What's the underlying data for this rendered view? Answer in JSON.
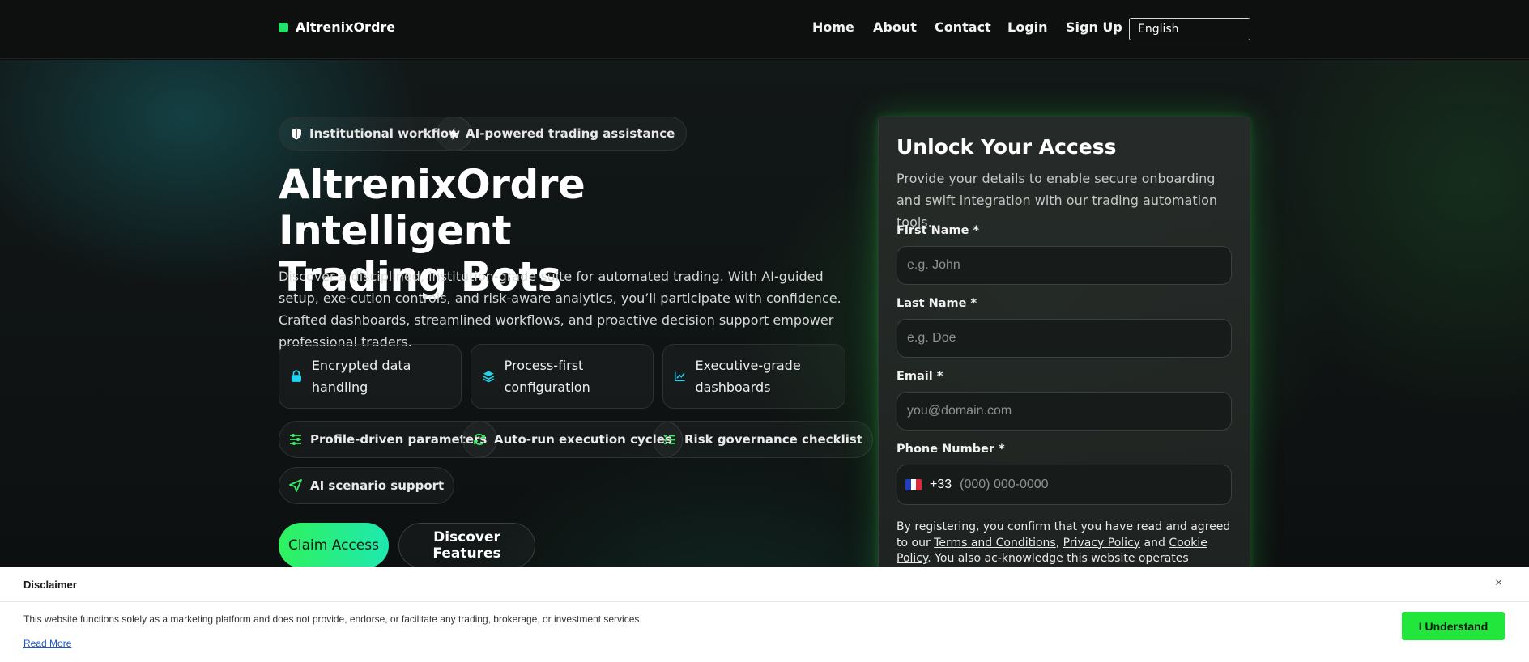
{
  "header": {
    "brand": "AltrenixOrdre",
    "nav": [
      "Home",
      "About",
      "Contact",
      "Login",
      "Sign Up"
    ],
    "language": "English"
  },
  "hero": {
    "badges": [
      "Institutional workflow",
      "AI-powered trading assistance"
    ],
    "title_line1": "AltrenixOrdre Intelligent",
    "title_line2": "Trading Bots",
    "lead": "Discover a disciplined, institution-grade suite for automated trading. With AI-guided setup, exe-cution controls, and risk-aware analytics, you’ll participate with confidence. Crafted dashboards, streamlined workflows, and proactive decision support empower professional traders.",
    "cards": [
      {
        "label": "Encrypted data handling",
        "icon": "lock-icon"
      },
      {
        "label": "Process-first configuration",
        "icon": "layers-icon"
      },
      {
        "label": "Executive-grade dashboards",
        "icon": "chart-line-icon"
      }
    ],
    "chips": [
      {
        "label": "Profile-driven parameters",
        "icon": "sliders-icon"
      },
      {
        "label": "Auto-run execution cycles",
        "icon": "refresh-icon"
      },
      {
        "label": "Risk governance checklist",
        "icon": "checklist-icon"
      },
      {
        "label": "AI scenario support",
        "icon": "send-icon"
      }
    ],
    "cta_primary": "Claim Access",
    "cta_secondary": "Discover Features"
  },
  "form": {
    "title": "Unlock Your Access",
    "subtitle": "Provide your details to enable secure onboarding and swift integration with our trading automation tools.",
    "first_name_label": "First Name *",
    "first_name_placeholder": "e.g. John",
    "last_name_label": "Last Name *",
    "last_name_placeholder": "e.g. Doe",
    "email_label": "Email *",
    "email_placeholder": "you@domain.com",
    "phone_label": "Phone Number *",
    "dial_code": "+33",
    "phone_placeholder": "(000) 000-0000",
    "consent_prefix": "By registering, you confirm that you have read and agreed to our ",
    "terms_link": "Terms and Conditions",
    "sep1": ", ",
    "privacy_link": "Privacy Policy",
    "and": " and ",
    "cookie_link": "Cookie Policy",
    "consent_suffix": ". You also ac-knowledge this website operates exclusively as a marketing plat-"
  },
  "disclaimer": {
    "title": "Disclaimer",
    "close": "×",
    "text": "This website functions solely as a marketing platform and does not provide, endorse, or facilitate any trading, brokerage, or investment services.",
    "read_more": "Read More",
    "button": "I Understand"
  },
  "colors": {
    "accent_green": "#22e36a",
    "accent_cyan": "#22d3ee",
    "flag_blue": "#1f3fbf",
    "flag_red": "#e0283a"
  }
}
